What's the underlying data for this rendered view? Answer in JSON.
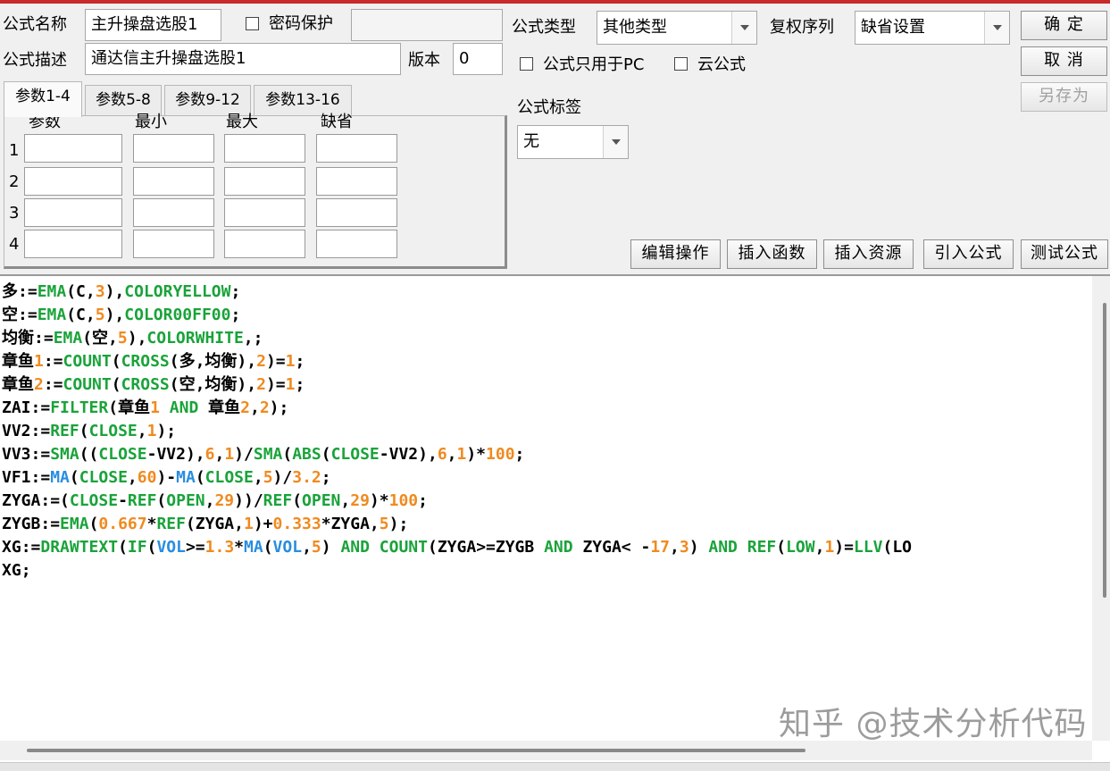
{
  "top": {
    "formula_name_label": "公式名称",
    "formula_name_value": "主升操盘选股1",
    "password_label": "密码保护",
    "description_label": "公式描述",
    "description_value": "通达信主升操盘选股1",
    "version_label": "版本",
    "version_value": "0",
    "type_label": "公式类型",
    "type_value": "其他类型",
    "rights_label": "复权序列",
    "rights_value": "缺省设置",
    "pc_only_label": "公式只用于PC",
    "cloud_label": "云公式",
    "tag_label": "公式标签",
    "tag_value": "无"
  },
  "buttons": {
    "ok": "确 定",
    "cancel": "取 消",
    "save_as": "另存为",
    "edit": "编辑操作",
    "insert_func": "插入函数",
    "insert_res": "插入资源",
    "import": "引入公式",
    "test": "测试公式"
  },
  "tabs": [
    "参数1-4",
    "参数5-8",
    "参数9-12",
    "参数13-16"
  ],
  "params": {
    "headers": [
      "参数",
      "最小",
      "最大",
      "缺省"
    ],
    "rows": [
      "1",
      "2",
      "3",
      "4"
    ]
  },
  "code_lines": [
    "多:=EMA(C,3),COLORYELLOW;",
    "空:=EMA(C,5),COLOR00FF00;",
    "均衡:=EMA(空,5),COLORWHITE,;",
    "章鱼1:=COUNT(CROSS(多,均衡),2)=1;",
    "章鱼2:=COUNT(CROSS(空,均衡),2)=1;",
    "ZAI:=FILTER(章鱼1 AND 章鱼2,2);",
    "VV2:=REF(CLOSE,1);",
    "VV3:=SMA((CLOSE-VV2),6,1)/SMA(ABS(CLOSE-VV2),6,1)*100;",
    "VF1:=MA(CLOSE,60)-MA(CLOSE,5)/3.2;",
    "ZYGA:=(CLOSE-REF(OPEN,29))/REF(OPEN,29)*100;",
    "ZYGB:=EMA(0.667*REF(ZYGA,1)+0.333*ZYGA,5);",
    "XG:=DRAWTEXT(IF(VOL>=1.3*MA(VOL,5) AND COUNT(ZYGA>=ZYGB AND ZYGA< -17,3) AND REF(LOW,1)=LLV(LO",
    "XG;"
  ],
  "watermark": "知乎 @技术分析代码",
  "colors": {
    "keyword": "#1aa33a",
    "number": "#f08a1f",
    "blue_func": "#2a8de0",
    "title_bar": "#c8292b"
  }
}
